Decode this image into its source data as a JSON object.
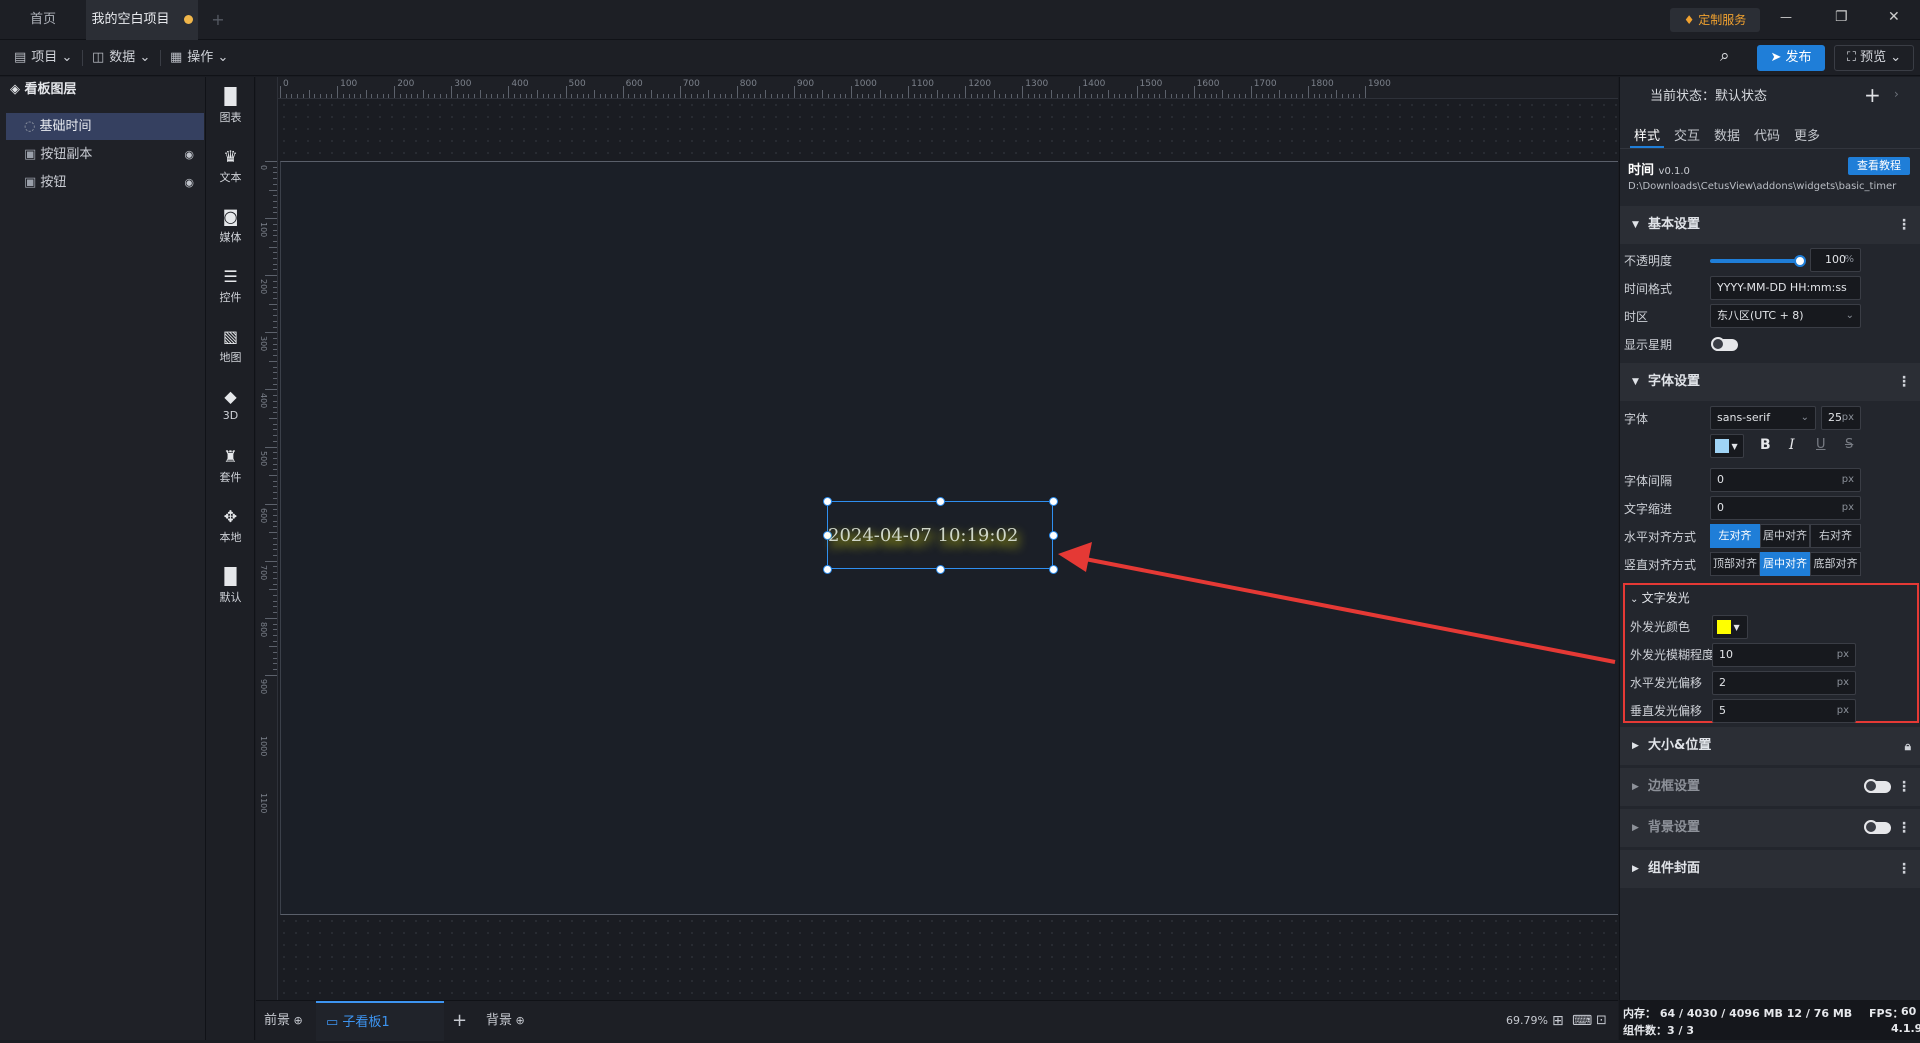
{
  "titlebar": {
    "tabs": [
      {
        "label": "首页"
      },
      {
        "label": "我的空白项目"
      }
    ],
    "custom_service": "定制服务",
    "add_tab": "+",
    "win_min": "—",
    "win_max": "❐",
    "win_close": "✕"
  },
  "menubar": {
    "project": "项目",
    "data": "数据",
    "operate": "操作",
    "publish": "发布",
    "preview": "预览"
  },
  "layers": {
    "title": "看板图层",
    "items": [
      {
        "label": "基础时间"
      },
      {
        "label": "按钮副本"
      },
      {
        "label": "按钮"
      }
    ]
  },
  "toolbox": {
    "items": [
      {
        "label": "图表"
      },
      {
        "label": "文本"
      },
      {
        "label": "媒体"
      },
      {
        "label": "控件"
      },
      {
        "label": "地图"
      },
      {
        "label": "3D"
      },
      {
        "label": "套件"
      },
      {
        "label": "本地"
      },
      {
        "label": "默认"
      }
    ]
  },
  "ruler": {
    "top": [
      "0",
      "100",
      "200",
      "300",
      "400",
      "500",
      "600",
      "700",
      "800",
      "900",
      "1000",
      "1100",
      "1200",
      "1300",
      "1400",
      "1500",
      "1600",
      "1700",
      "1800",
      "1900"
    ],
    "left": [
      "0",
      "100",
      "200",
      "300",
      "400",
      "500",
      "600",
      "700",
      "800",
      "900",
      "1000",
      "1100"
    ]
  },
  "canvas": {
    "time_text": "2024-04-07 10:19:02"
  },
  "bottombar": {
    "front": "前景",
    "sub_board": "子看板1",
    "add": "+",
    "back": "背景",
    "zoom": "69.79%"
  },
  "props": {
    "state": "当前状态：默认状态",
    "tabs": [
      {
        "label": "样式"
      },
      {
        "label": "交互"
      },
      {
        "label": "数据"
      },
      {
        "label": "代码"
      },
      {
        "label": "更多"
      }
    ],
    "widget_name": "时间",
    "widget_version": "v0.1.0",
    "tutorial": "查看教程",
    "widget_path": "D:\\Downloads\\CetusView\\addons\\widgets\\basic_timer",
    "basic": {
      "title": "基本设置",
      "opacity_label": "不透明度",
      "opacity_value": "100",
      "opacity_unit": "%",
      "opacity_level": 1.0,
      "format_label": "时间格式",
      "format_value": "YYYY-MM-DD HH:mm:ss",
      "tz_label": "时区",
      "tz_value": "东八区(UTC + 8)",
      "week_label": "显示星期"
    },
    "font": {
      "title": "字体设置",
      "font_label": "字体",
      "font_value": "sans-serif",
      "size_value": "25",
      "size_unit": "px",
      "color": "#9fd3f5",
      "bold": "B",
      "italic": "I",
      "underline": "U",
      "strike": "S",
      "spacing_label": "字体间隔",
      "spacing_value": "0",
      "spacing_unit": "px",
      "indent_label": "文字缩进",
      "indent_value": "0",
      "indent_unit": "px",
      "halign_label": "水平对齐方式",
      "halign": [
        "左对齐",
        "居中对齐",
        "右对齐"
      ],
      "valign_label": "竖直对齐方式",
      "valign": [
        "顶部对齐",
        "居中对齐",
        "底部对齐"
      ]
    },
    "glow": {
      "title": "文字发光",
      "color_label": "外发光颜色",
      "color": "#ffff00",
      "blur_label": "外发光模糊程度",
      "blur_value": "10",
      "blur_unit": "px",
      "hoff_label": "水平发光偏移",
      "hoff_value": "2",
      "hoff_unit": "px",
      "voff_label": "垂直发光偏移",
      "voff_value": "5",
      "voff_unit": "px"
    },
    "sections": [
      {
        "label": "大小&位置"
      },
      {
        "label": "边框设置"
      },
      {
        "label": "背景设置"
      },
      {
        "label": "组件封面"
      }
    ]
  },
  "status": {
    "memory": "内存： 64 / 4030 / 4096 MB  12 / 76 MB",
    "fps_label": "FPS：",
    "fps_value": "60",
    "components": "组件数：3 / 3",
    "version": "4.1.9"
  },
  "colors": {
    "accent": "#1f7ed8",
    "annotation": "#e53935",
    "glow": "#ffff00"
  }
}
